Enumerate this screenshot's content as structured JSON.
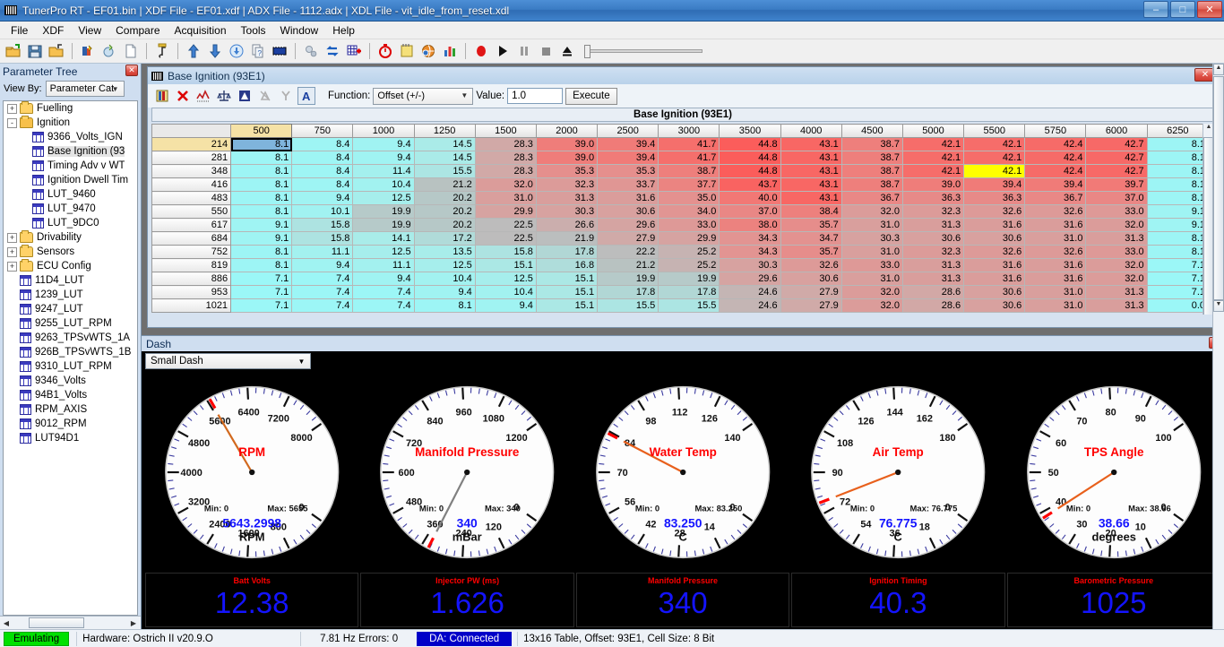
{
  "window": {
    "title": "TunerPro RT - EF01.bin | XDF File - EF01.xdf | ADX File - 1112.adx | XDL File - vit_idle_from_reset.xdl",
    "minimize": "–",
    "maximize": "□",
    "close": "✕"
  },
  "menu": [
    "File",
    "XDF",
    "View",
    "Compare",
    "Acquisition",
    "Tools",
    "Window",
    "Help"
  ],
  "sidebar": {
    "title": "Parameter Tree",
    "close_label": "✕",
    "view_by_label": "View By:",
    "view_by_value": "Parameter Cat",
    "tree": [
      {
        "label": "Fuelling",
        "indent": 0,
        "icon": "folder",
        "expander": "+",
        "selected": false
      },
      {
        "label": "Ignition",
        "indent": 0,
        "icon": "folder-open",
        "expander": "-",
        "selected": false
      },
      {
        "label": "9366_Volts_IGN",
        "indent": 1,
        "icon": "table",
        "expander": "",
        "selected": false
      },
      {
        "label": "Base Ignition (93",
        "indent": 1,
        "icon": "table",
        "expander": "",
        "selected": true
      },
      {
        "label": "Timing Adv v WT",
        "indent": 1,
        "icon": "table",
        "expander": "",
        "selected": false
      },
      {
        "label": "Ignition Dwell Tim",
        "indent": 1,
        "icon": "table",
        "expander": "",
        "selected": false
      },
      {
        "label": "LUT_9460",
        "indent": 1,
        "icon": "table",
        "expander": "",
        "selected": false
      },
      {
        "label": "LUT_9470",
        "indent": 1,
        "icon": "table",
        "expander": "",
        "selected": false
      },
      {
        "label": "LUT_9DC0",
        "indent": 1,
        "icon": "table",
        "expander": "",
        "selected": false
      },
      {
        "label": "Drivability",
        "indent": 0,
        "icon": "folder",
        "expander": "+",
        "selected": false
      },
      {
        "label": "Sensors",
        "indent": 0,
        "icon": "folder",
        "expander": "+",
        "selected": false
      },
      {
        "label": "ECU Config",
        "indent": 0,
        "icon": "folder",
        "expander": "+",
        "selected": false
      },
      {
        "label": "11D4_LUT",
        "indent": 0,
        "icon": "table",
        "expander": "",
        "selected": false
      },
      {
        "label": "1239_LUT",
        "indent": 0,
        "icon": "table",
        "expander": "",
        "selected": false
      },
      {
        "label": "9247_LUT",
        "indent": 0,
        "icon": "table",
        "expander": "",
        "selected": false
      },
      {
        "label": "9255_LUT_RPM",
        "indent": 0,
        "icon": "table",
        "expander": "",
        "selected": false
      },
      {
        "label": "9263_TPSvWTS_1A",
        "indent": 0,
        "icon": "table",
        "expander": "",
        "selected": false
      },
      {
        "label": "926B_TPSvWTS_1B",
        "indent": 0,
        "icon": "table",
        "expander": "",
        "selected": false
      },
      {
        "label": "9310_LUT_RPM",
        "indent": 0,
        "icon": "table",
        "expander": "",
        "selected": false
      },
      {
        "label": "9346_Volts",
        "indent": 0,
        "icon": "table",
        "expander": "",
        "selected": false
      },
      {
        "label": "94B1_Volts",
        "indent": 0,
        "icon": "table",
        "expander": "",
        "selected": false
      },
      {
        "label": "RPM_AXIS",
        "indent": 0,
        "icon": "table",
        "expander": "",
        "selected": false
      },
      {
        "label": "9012_RPM",
        "indent": 0,
        "icon": "table",
        "expander": "",
        "selected": false
      },
      {
        "label": "LUT94D1",
        "indent": 0,
        "icon": "table",
        "expander": "",
        "selected": false
      }
    ]
  },
  "table_window": {
    "title": "Base Ignition (93E1)",
    "close_label": "✕",
    "function_label": "Function:",
    "function_value": "Offset (+/-)",
    "value_label": "Value:",
    "value_value": "1.0",
    "execute_label": "Execute",
    "caption": "Base Ignition (93E1)",
    "columns": [
      "500",
      "750",
      "1000",
      "1250",
      "1500",
      "2000",
      "2500",
      "3000",
      "3500",
      "4000",
      "4500",
      "5000",
      "5500",
      "5750",
      "6000",
      "6250"
    ],
    "rows": [
      "214",
      "281",
      "348",
      "416",
      "483",
      "550",
      "617",
      "684",
      "752",
      "819",
      "886",
      "953",
      "1021"
    ],
    "selected_cell": {
      "row": 0,
      "col": 0
    },
    "highlight_cell": {
      "row": 2,
      "col": 12
    },
    "values": [
      [
        "8.1",
        "8.4",
        "9.4",
        "14.5",
        "28.3",
        "39.0",
        "39.4",
        "41.7",
        "44.8",
        "43.1",
        "38.7",
        "42.1",
        "42.1",
        "42.4",
        "42.7",
        "8.1"
      ],
      [
        "8.1",
        "8.4",
        "9.4",
        "14.5",
        "28.3",
        "39.0",
        "39.4",
        "41.7",
        "44.8",
        "43.1",
        "38.7",
        "42.1",
        "42.1",
        "42.4",
        "42.7",
        "8.1"
      ],
      [
        "8.1",
        "8.4",
        "11.4",
        "15.5",
        "28.3",
        "35.3",
        "35.3",
        "38.7",
        "44.8",
        "43.1",
        "38.7",
        "42.1",
        "42.1",
        "42.4",
        "42.7",
        "8.1"
      ],
      [
        "8.1",
        "8.4",
        "10.4",
        "21.2",
        "32.0",
        "32.3",
        "33.7",
        "37.7",
        "43.7",
        "43.1",
        "38.7",
        "39.0",
        "39.4",
        "39.4",
        "39.7",
        "8.1"
      ],
      [
        "8.1",
        "9.4",
        "12.5",
        "20.2",
        "31.0",
        "31.3",
        "31.6",
        "35.0",
        "40.0",
        "43.1",
        "36.7",
        "36.3",
        "36.3",
        "36.7",
        "37.0",
        "8.1"
      ],
      [
        "8.1",
        "10.1",
        "19.9",
        "20.2",
        "29.9",
        "30.3",
        "30.6",
        "34.0",
        "37.0",
        "38.4",
        "32.0",
        "32.3",
        "32.6",
        "32.6",
        "33.0",
        "9.1"
      ],
      [
        "9.1",
        "15.8",
        "19.9",
        "20.2",
        "22.5",
        "26.6",
        "29.6",
        "33.0",
        "38.0",
        "35.7",
        "31.0",
        "31.3",
        "31.6",
        "31.6",
        "32.0",
        "9.1"
      ],
      [
        "9.1",
        "15.8",
        "14.1",
        "17.2",
        "22.5",
        "21.9",
        "27.9",
        "29.9",
        "34.3",
        "34.7",
        "30.3",
        "30.6",
        "30.6",
        "31.0",
        "31.3",
        "8.1"
      ],
      [
        "8.1",
        "11.1",
        "12.5",
        "13.5",
        "15.8",
        "17.8",
        "22.2",
        "25.2",
        "34.3",
        "35.7",
        "31.0",
        "32.3",
        "32.6",
        "32.6",
        "33.0",
        "8.1"
      ],
      [
        "8.1",
        "9.4",
        "11.1",
        "12.5",
        "15.1",
        "16.8",
        "21.2",
        "25.2",
        "30.3",
        "32.6",
        "33.0",
        "31.3",
        "31.6",
        "31.6",
        "32.0",
        "7.1"
      ],
      [
        "7.1",
        "7.4",
        "9.4",
        "10.4",
        "12.5",
        "15.1",
        "19.9",
        "19.9",
        "29.6",
        "30.6",
        "31.0",
        "31.3",
        "31.6",
        "31.6",
        "32.0",
        "7.1"
      ],
      [
        "7.1",
        "7.4",
        "7.4",
        "9.4",
        "10.4",
        "15.1",
        "17.8",
        "17.8",
        "24.6",
        "27.9",
        "32.0",
        "28.6",
        "30.6",
        "31.0",
        "31.3",
        "7.1"
      ],
      [
        "7.1",
        "7.4",
        "7.4",
        "8.1",
        "9.4",
        "15.1",
        "15.5",
        "15.5",
        "24.6",
        "27.9",
        "32.0",
        "28.6",
        "30.6",
        "31.0",
        "31.3",
        "0.0"
      ]
    ]
  },
  "dash": {
    "title": "Dash",
    "close_label": "✕",
    "selector_value": "Small Dash",
    "gauges": [
      {
        "name": "RPM",
        "unit": "RPM",
        "value": "5643.2998",
        "min_label": "Min: 0",
        "max_label": "Max: 5655",
        "min": 0,
        "max": 8000,
        "needle": 5643.3,
        "ticks": [
          "0",
          "800",
          "1600",
          "2400",
          "3200",
          "4000",
          "4800",
          "5600",
          "6400",
          "7200",
          "8000"
        ],
        "redline": 5655,
        "needle_color": "#d2691e"
      },
      {
        "name": "Manifold Pressure",
        "unit": "mBar",
        "value": "340",
        "min_label": "Min: 0",
        "max_label": "Max: 340",
        "min": 0,
        "max": 1200,
        "needle": 340,
        "ticks": [
          "0",
          "120",
          "240",
          "360",
          "480",
          "600",
          "720",
          "840",
          "960",
          "1080",
          "1200"
        ],
        "redline": 340,
        "needle_color": "#808080"
      },
      {
        "name": "Water Temp",
        "unit": "C",
        "value": "83.250",
        "min_label": "Min: 0",
        "max_label": "Max: 83.250",
        "min": 0,
        "max": 140,
        "needle": 83.25,
        "ticks": [
          "0",
          "14",
          "28",
          "42",
          "56",
          "70",
          "84",
          "98",
          "112",
          "126",
          "140"
        ],
        "redline": 83.25,
        "needle_color": "#e8601c"
      },
      {
        "name": "Air Temp",
        "unit": "C",
        "value": "76.775",
        "min_label": "Min: 0",
        "max_label": "Max: 76.775",
        "min": 0,
        "max": 180,
        "needle": 76.775,
        "ticks": [
          "0",
          "18",
          "36",
          "54",
          "72",
          "90",
          "108",
          "126",
          "144",
          "162",
          "180"
        ],
        "redline": 76.775,
        "needle_color": "#e8601c"
      },
      {
        "name": "TPS Angle",
        "unit": "degrees",
        "value": "38.66",
        "min_label": "Min: 0",
        "max_label": "Max: 38.66",
        "min": 0,
        "max": 100,
        "needle": 38.66,
        "ticks": [
          "0",
          "10",
          "20",
          "30",
          "40",
          "50",
          "60",
          "70",
          "80",
          "90",
          "100"
        ],
        "redline": 38.66,
        "needle_color": "#e8601c"
      }
    ],
    "numerics": [
      {
        "label": "Batt Volts",
        "value": "12.38"
      },
      {
        "label": "Injector PW (ms)",
        "value": "1.626"
      },
      {
        "label": "Manifold Pressure",
        "value": "340"
      },
      {
        "label": "Ignition Timing",
        "value": "40.3"
      },
      {
        "label": "Barometric Pressure",
        "value": "1025"
      }
    ]
  },
  "statusbar": {
    "emulating": "Emulating",
    "hardware": "Hardware: Ostrich II v20.9.O",
    "rate": "7.81 Hz   Errors: 0",
    "da": "DA: Connected",
    "table_info": "13x16 Table, Offset: 93E1,  Cell Size: 8 Bit"
  }
}
